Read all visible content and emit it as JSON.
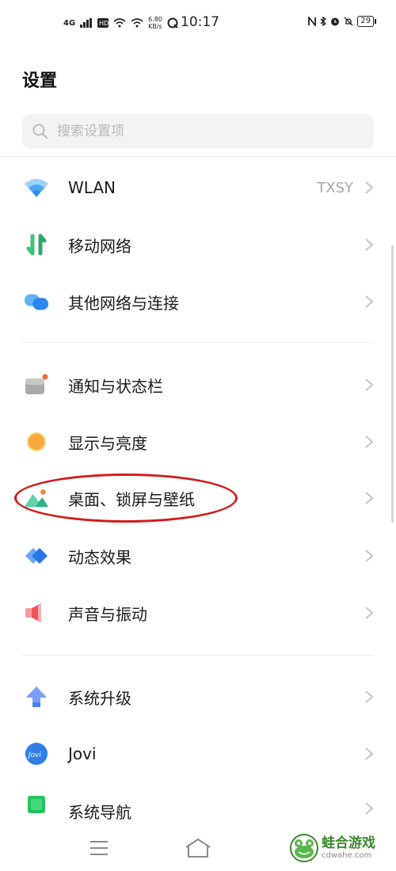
{
  "status_bar": {
    "network": "4G",
    "speed_top": "6.80",
    "speed_unit": "KB/s",
    "time": "10:17",
    "battery": "29",
    "icons": [
      "nfc-icon",
      "bluetooth-icon",
      "alarm-icon",
      "mute-icon"
    ]
  },
  "page": {
    "title": "设置"
  },
  "search": {
    "placeholder": "搜索设置项"
  },
  "groups": [
    {
      "items": [
        {
          "label": "WLAN",
          "value": "TXSY",
          "icon": "wifi-icon",
          "color": "#3aa0f2"
        },
        {
          "label": "移动网络",
          "icon": "mobile-data-icon",
          "color": "#35c47a"
        },
        {
          "label": "其他网络与连接",
          "icon": "connection-icon",
          "color": "#2a8ef0"
        }
      ]
    },
    {
      "items": [
        {
          "label": "通知与状态栏",
          "icon": "notification-icon",
          "color": "#9a9a9a"
        },
        {
          "label": "显示与亮度",
          "icon": "brightness-icon",
          "color": "#f6b23a"
        },
        {
          "label": "桌面、锁屏与壁纸",
          "icon": "wallpaper-icon",
          "color": "#2fb38a"
        },
        {
          "label": "动态效果",
          "icon": "motion-icon",
          "color": "#2a7de8"
        },
        {
          "label": "声音与振动",
          "icon": "sound-icon",
          "color": "#f0555a"
        }
      ]
    },
    {
      "items": [
        {
          "label": "系统升级",
          "icon": "upgrade-icon",
          "color": "#4d7ff0"
        },
        {
          "label": "Jovi",
          "icon": "jovi-icon",
          "color": "#2f7fe6"
        },
        {
          "label": "系统导航",
          "icon": "navigation-icon",
          "color": "#22c45e"
        }
      ]
    }
  ],
  "watermark": {
    "name": "蛙合游戏",
    "domain": "cdwahe.com"
  },
  "highlight_color": "#d41b1b"
}
